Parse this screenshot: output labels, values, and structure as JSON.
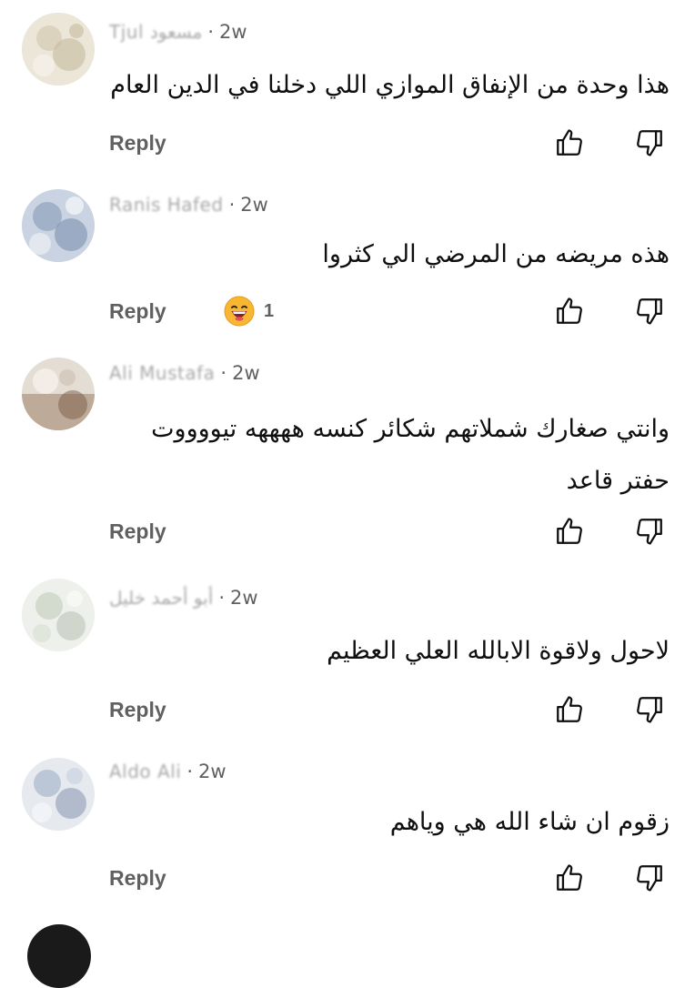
{
  "comments": [
    {
      "username": "Tjul مسعود",
      "time": "2w",
      "text": "هذا وحدة من الإنفاق الموازي اللي دخلنا في الدين العام",
      "reply_label": "Reply",
      "avatar_colors": [
        "#e8e2d4",
        "#c9bfa8",
        "#f3efe6"
      ]
    },
    {
      "username": "Ranis Hafed",
      "time": "2w",
      "text": "هذه مريضه من المرضي الي كثروا",
      "reply_label": "Reply",
      "reaction": {
        "emoji": "😄",
        "count": "1"
      },
      "avatar_colors": [
        "#a9b9cf",
        "#6f86a6",
        "#dde3ec"
      ]
    },
    {
      "username": "Ali Mustafa",
      "time": "2w",
      "text": "وانتي صغارك شملاتهم شكائر كنسه ههههه  تيووووت حفتر قاعد",
      "reply_label": "Reply",
      "avatar_colors": [
        "#d8d0c4",
        "#8a6f58",
        "#f0ece6"
      ]
    },
    {
      "username": "أبو أحمد خليل",
      "time": "2w",
      "text": "لاحول ولاقوة الابالله العلي العظيم",
      "reply_label": "Reply",
      "avatar_colors": [
        "#e6e8e2",
        "#b9c2b4",
        "#f5f5f2"
      ]
    },
    {
      "username": "Aldo Ali",
      "time": "2w",
      "text": "زقوم ان شاء الله  هي وياهم",
      "reply_label": "Reply",
      "avatar_colors": [
        "#dfe3ea",
        "#7f8ea6",
        "#f2f3f6"
      ]
    }
  ],
  "icons": {
    "like": "thumbs-up-icon",
    "dislike": "thumbs-down-icon"
  },
  "colors": {
    "meta": "#606060",
    "text": "#0f0f0f",
    "background": "#ffffff"
  }
}
